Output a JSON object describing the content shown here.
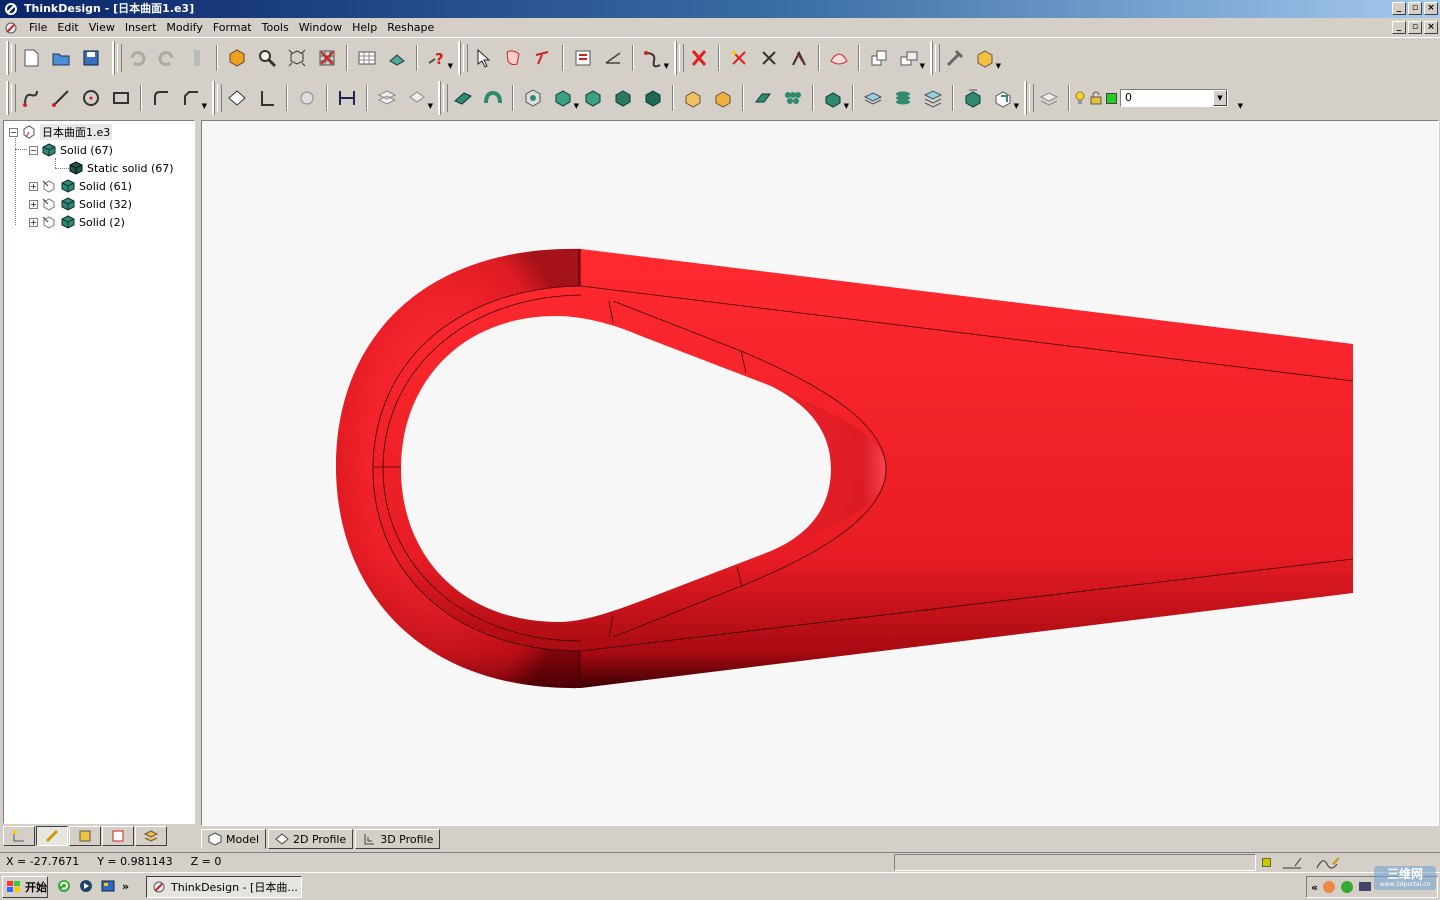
{
  "window": {
    "title": "ThinkDesign - [日本曲面1.e3]"
  },
  "menu": [
    "File",
    "Edit",
    "View",
    "Insert",
    "Modify",
    "Format",
    "Tools",
    "Window",
    "Help",
    "Reshape"
  ],
  "layer": {
    "value": "0",
    "color": "#22cc22"
  },
  "tree": {
    "root": "日本曲面1.e3",
    "nodes": [
      {
        "label": "Solid (67)"
      },
      {
        "label": "Static solid (67)"
      },
      {
        "label": "Solid (61)"
      },
      {
        "label": "Solid (32)"
      },
      {
        "label": "Solid (2)"
      }
    ]
  },
  "tabs": [
    {
      "label": "Model"
    },
    {
      "label": "2D Profile"
    },
    {
      "label": "3D Profile"
    }
  ],
  "status": {
    "x": "X = -27.7671",
    "y": "Y = 0.981143",
    "z": "Z = 0"
  },
  "taskbar": {
    "start": "开始",
    "task": "ThinkDesign - [日本曲...",
    "chevron": "»",
    "tray_chevron": "«"
  },
  "watermark": {
    "text": "三维网",
    "sub": "www.3dportal.cn"
  },
  "colors": {
    "part": "#e8202a",
    "solid_icon": "#2e8b6e",
    "accent_select": "#cc2222"
  },
  "icons": {
    "toolbar1": [
      "new-icon",
      "open-icon",
      "save-icon",
      "undo-icon",
      "redo-icon",
      "cut-icon",
      "shade-icon",
      "zoom-icon",
      "fit-icon",
      "grid-icon",
      "table-icon",
      "print-icon",
      "help-icon",
      "select-icon",
      "select-face-icon",
      "select-edge-icon",
      "insert-icon",
      "measure-icon",
      "curve-icon",
      "delete-icon",
      "split-icon",
      "trim-icon",
      "extend-icon",
      "surface-icon",
      "offset-icon",
      "copy-icon",
      "tool-icon",
      "box-icon"
    ],
    "toolbar2": [
      "spline-icon",
      "line-icon",
      "circle-icon",
      "rect-icon",
      "fillet-curve-icon",
      "chamfer-curve-icon",
      "plane-icon",
      "axis-icon",
      "sweep-icon",
      "dimension-icon",
      "loft-icon",
      "rotate-icon",
      "extrude-icon",
      "revolve-icon",
      "hole-icon",
      "pad-icon",
      "pocket-icon",
      "shell-icon",
      "draft-icon",
      "boolean-add-icon",
      "boolean-sub-icon",
      "fillet-icon",
      "pattern-icon",
      "mirror-icon",
      "split-solid-icon",
      "section-icon",
      "stack-icon",
      "layer-icon",
      "explode-icon",
      "transform-icon",
      "layers-icon",
      "bulb-icon",
      "lock-icon"
    ]
  }
}
